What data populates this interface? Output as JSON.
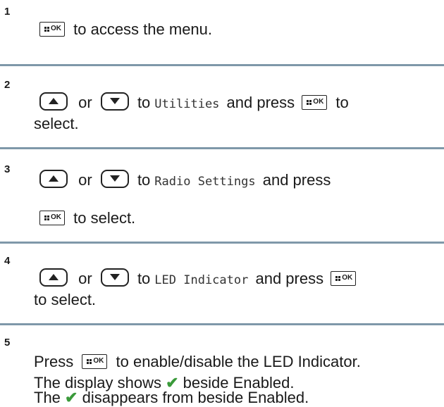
{
  "steps": [
    {
      "num": "1",
      "t1": "to access the menu."
    },
    {
      "num": "2",
      "or": "or",
      "to": "to",
      "menu": "Utilities",
      "and_press": "and press",
      "to2": "to",
      "select": "select."
    },
    {
      "num": "3",
      "or": "or",
      "to": "to",
      "menu": "Radio Settings",
      "and_press": "and press",
      "to_select": "to select."
    },
    {
      "num": "4",
      "or": "or",
      "to": "to",
      "menu": "LED Indicator",
      "and_press": "and press",
      "to_select": "to select."
    },
    {
      "num": "5",
      "press": "Press",
      "rest": "to enable/disable the LED Indicator.",
      "shows_pre": "The display shows",
      "shows_post": "beside Enabled.",
      "dis_pre": "The",
      "dis_post": "disappears from beside Enabled."
    }
  ],
  "keys": {
    "ok": "OK",
    "check": "✔"
  },
  "colors": {
    "divider": "#7f98a9",
    "check": "#3a9a3a"
  }
}
